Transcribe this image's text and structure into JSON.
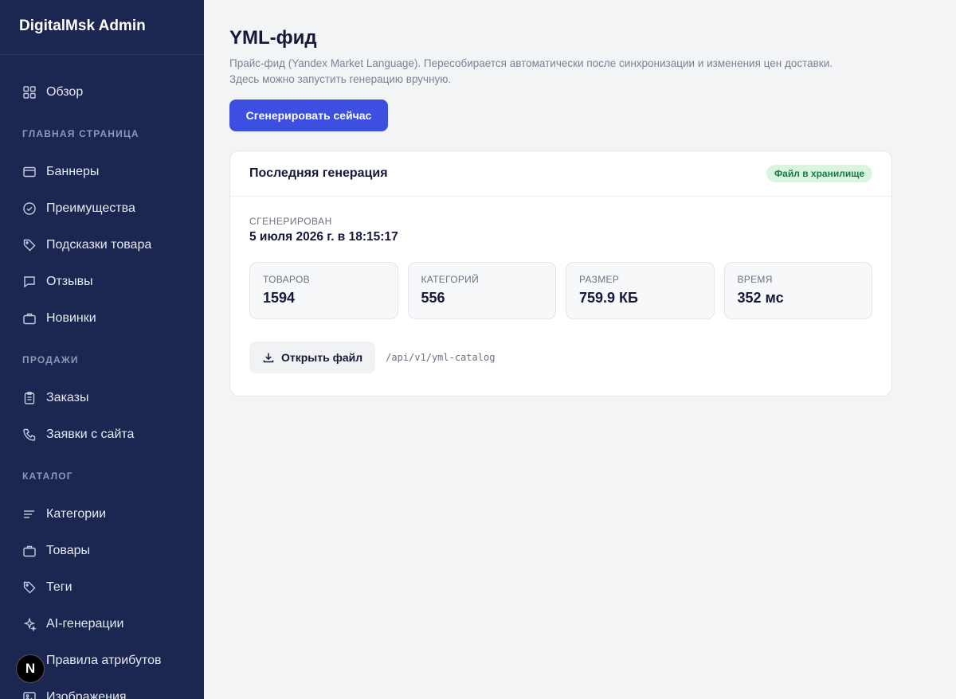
{
  "app": {
    "title": "DigitalMsk Admin"
  },
  "sidebar": {
    "overview": {
      "label": "Обзор",
      "icon": "grid-icon"
    },
    "sections": [
      {
        "title": "Главная страница",
        "items": [
          {
            "label": "Баннеры",
            "icon": "card-icon"
          },
          {
            "label": "Преимущества",
            "icon": "check-circle-icon"
          },
          {
            "label": "Подсказки товара",
            "icon": "tag-icon"
          },
          {
            "label": "Отзывы",
            "icon": "message-icon"
          },
          {
            "label": "Новинки",
            "icon": "briefcase-icon"
          }
        ]
      },
      {
        "title": "Продажи",
        "items": [
          {
            "label": "Заказы",
            "icon": "clipboard-icon"
          },
          {
            "label": "Заявки с сайта",
            "icon": "phone-icon"
          }
        ]
      },
      {
        "title": "Каталог",
        "items": [
          {
            "label": "Категории",
            "icon": "lines-icon"
          },
          {
            "label": "Товары",
            "icon": "briefcase-icon"
          },
          {
            "label": "Теги",
            "icon": "tag-icon"
          },
          {
            "label": "AI-генерации",
            "icon": "sparkle-icon"
          },
          {
            "label": "Правила атрибутов",
            "icon": "list-check-icon"
          },
          {
            "label": "Изображения",
            "icon": "image-icon"
          }
        ]
      }
    ]
  },
  "badge_overlay": {
    "letter": "N"
  },
  "page": {
    "title": "YML-фид",
    "description": "Прайс-фид (Yandex Market Language). Пересобирается автоматически после синхронизации и изменения цен доставки. Здесь можно запустить генерацию вручную.",
    "generate_button": "Сгенерировать сейчас"
  },
  "card": {
    "title": "Последняя генерация",
    "status_badge": "Файл в хранилище",
    "generated_label": "СГЕНЕРИРОВАН",
    "generated_value": "5 июля 2026 г. в 18:15:17",
    "stats": [
      {
        "label": "ТОВАРОВ",
        "value": "1594"
      },
      {
        "label": "КАТЕГОРИЙ",
        "value": "556"
      },
      {
        "label": "РАЗМЕР",
        "value": "759.9 КБ"
      },
      {
        "label": "ВРЕМЯ",
        "value": "352 мс"
      }
    ],
    "open_file_button": "Открыть файл",
    "file_path": "/api/v1/yml-catalog"
  },
  "colors": {
    "sidebar_bg": "#1b2651",
    "accent": "#3d4fe0",
    "badge_bg": "#d8f5e2",
    "badge_text": "#1c7a42"
  }
}
